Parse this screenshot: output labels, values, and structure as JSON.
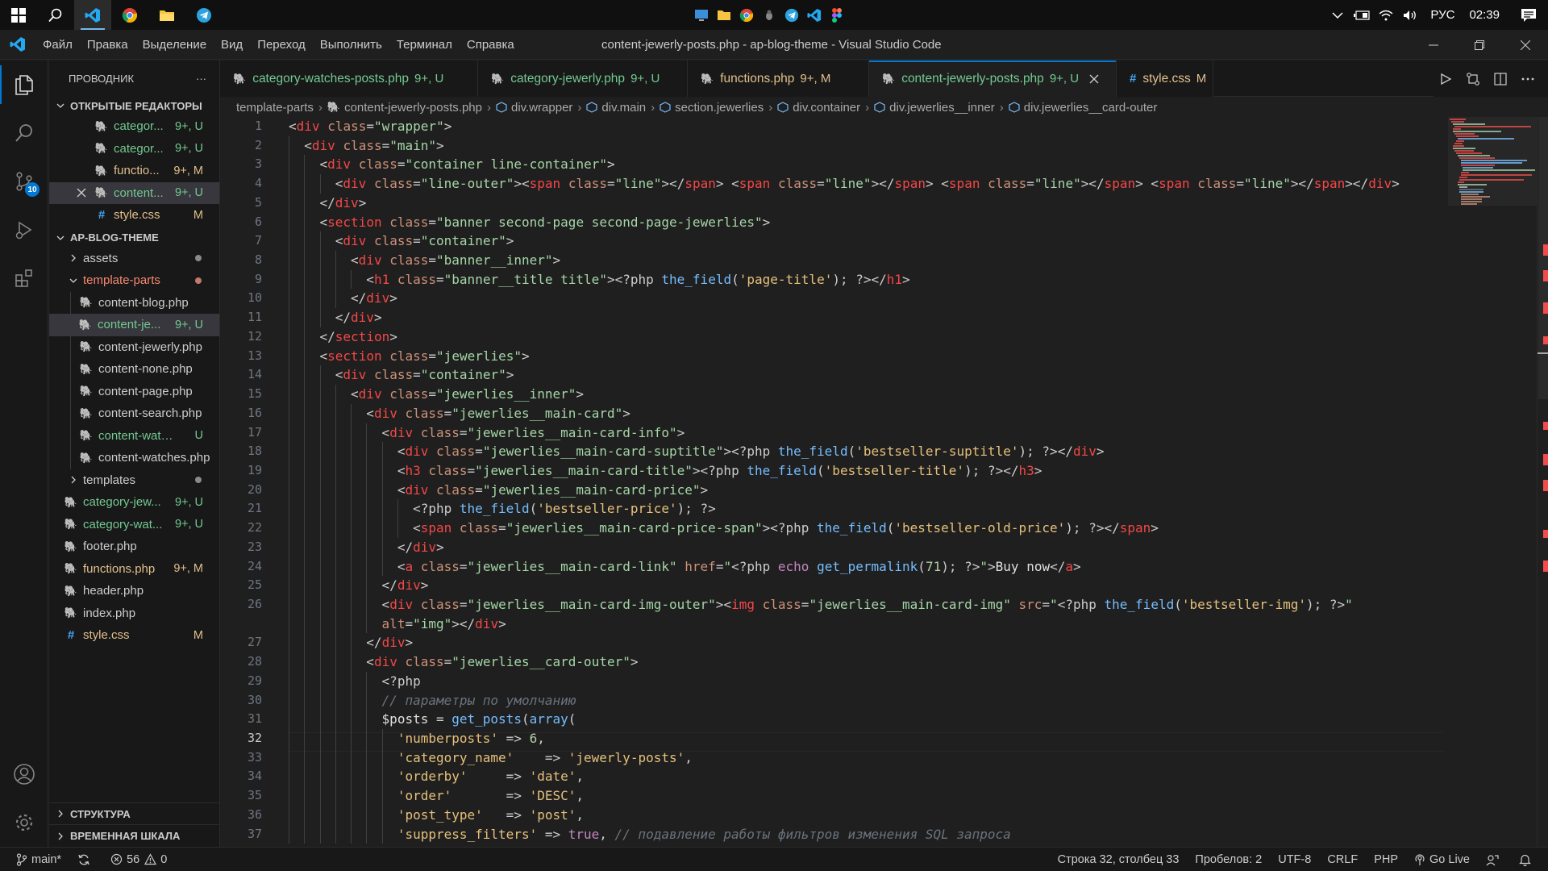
{
  "taskbar": {
    "language": "РУС",
    "clock": "02:39"
  },
  "menu": [
    "Файл",
    "Правка",
    "Выделение",
    "Вид",
    "Переход",
    "Выполнить",
    "Терминал",
    "Справка"
  ],
  "window_title": "content-jewerly-posts.php - ap-blog-theme - Visual Studio Code",
  "activity": {
    "scm_badge": "10"
  },
  "sidebar": {
    "header": "ПРОВОДНИК",
    "more": "···",
    "open_editors_title": "ОТКРЫТЫЕ РЕДАКТОРЫ",
    "open_editors": [
      {
        "name": "categor...",
        "status": "9+, U",
        "type": "php"
      },
      {
        "name": "categor...",
        "status": "9+, U",
        "type": "php"
      },
      {
        "name": "functio...",
        "status": "9+, M",
        "type": "php"
      },
      {
        "name": "content...",
        "status": "9+, U",
        "type": "php"
      },
      {
        "name": "style.css",
        "status": "M",
        "type": "css"
      }
    ],
    "project_title": "AP-BLOG-THEME",
    "tree": {
      "assets": "assets",
      "template_parts": "template-parts",
      "content_blog": "content-blog.php",
      "content_je": "content-je...",
      "content_je_status": "9+, U",
      "content_jewerly": "content-jewerly.php",
      "content_none": "content-none.php",
      "content_page": "content-page.php",
      "content_search": "content-search.php",
      "content_watch": "content-watch...",
      "content_watch_status": "U",
      "content_watches": "content-watches.php",
      "templates": "templates",
      "category_jew": "category-jew...",
      "category_jew_status": "9+, U",
      "category_wat": "category-wat...",
      "category_wat_status": "9+, U",
      "footer": "footer.php",
      "functions": "functions.php",
      "functions_status": "9+, M",
      "header": "header.php",
      "index": "index.php",
      "style": "style.css",
      "style_status": "M"
    },
    "structure": "СТРУКТУРА",
    "timeline": "ВРЕМЕННАЯ ШКАЛА"
  },
  "tabs": [
    {
      "label": "category-watches-posts.php",
      "status": "9+, U"
    },
    {
      "label": "category-jewerly.php",
      "status": "9+, U"
    },
    {
      "label": "functions.php",
      "status": "9+, M"
    },
    {
      "label": "content-jewerly-posts.php",
      "status": "9+, U"
    },
    {
      "label": "style.css",
      "status": "M"
    }
  ],
  "breadcrumb": [
    "template-parts",
    "content-jewerly-posts.php",
    "div.wrapper",
    "div.main",
    "section.jewerlies",
    "div.container",
    "div.jewerlies__inner",
    "div.jewerlies__card-outer"
  ],
  "line_numbers": [
    "1",
    "2",
    "3",
    "4",
    "5",
    "6",
    "7",
    "8",
    "9",
    "10",
    "11",
    "12",
    "13",
    "14",
    "15",
    "16",
    "17",
    "18",
    "19",
    "20",
    "21",
    "22",
    "23",
    "24",
    "25",
    "26",
    "27",
    "28",
    "29",
    "30",
    "31",
    "32",
    "33",
    "34",
    "35",
    "36",
    "37"
  ],
  "status": {
    "branch": "main*",
    "errors": "56",
    "warnings": "0",
    "position": "Строка 32, столбец 33",
    "spaces": "Пробелов: 2",
    "encoding": "UTF-8",
    "eol": "CRLF",
    "language": "PHP",
    "golive": "Go Live"
  },
  "colors": {
    "accent": "#0078d4",
    "untracked": "#73c991",
    "modified": "#e2c08d",
    "error": "#f14c4c"
  }
}
